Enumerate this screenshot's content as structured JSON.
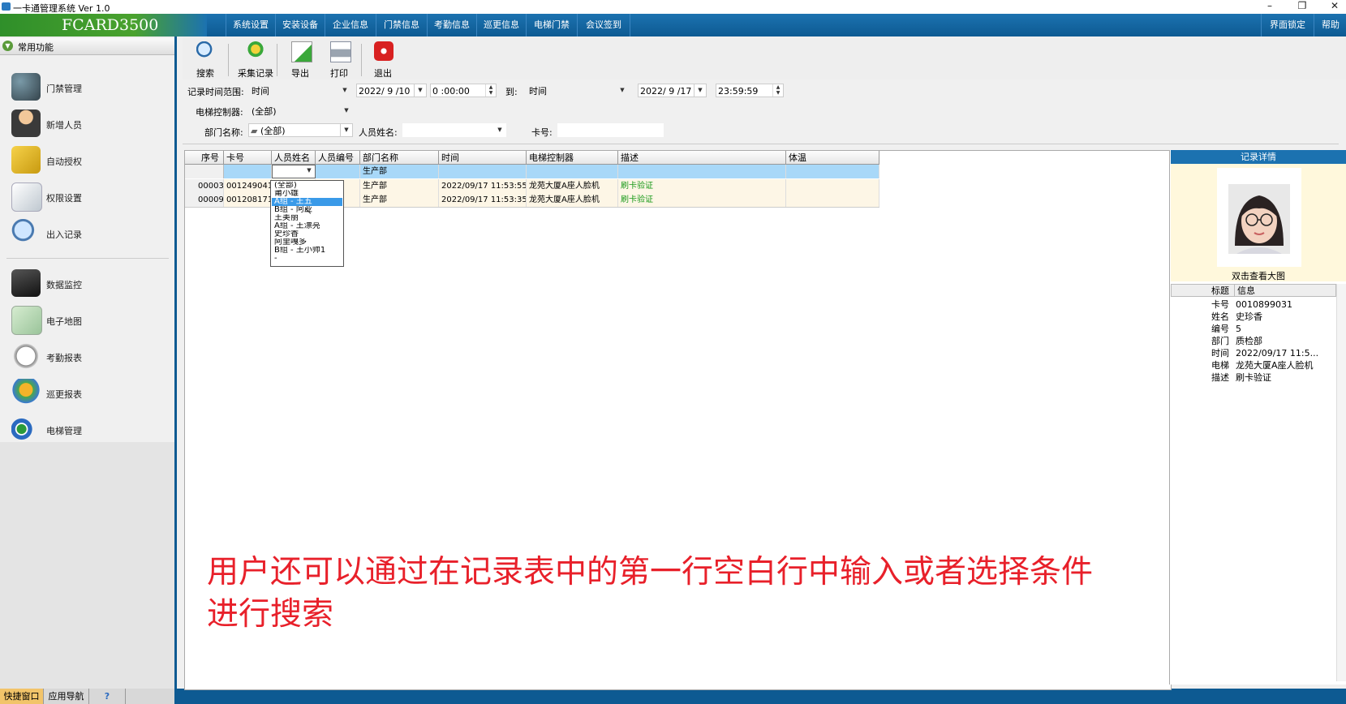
{
  "window": {
    "title": "一卡通管理系统  Ver 1.0",
    "brand": "FCARD3500"
  },
  "menu": [
    "系统设置",
    "安装设备",
    "企业信息",
    "门禁信息",
    "考勤信息",
    "巡更信息",
    "电梯门禁",
    "会议签到"
  ],
  "menu_right": [
    "界面锁定",
    "帮助"
  ],
  "sidebar": {
    "header": "常用功能",
    "items": [
      "门禁管理",
      "新增人员",
      "自动授权",
      "权限设置",
      "出入记录",
      "数据监控",
      "电子地图",
      "考勤报表",
      "巡更报表",
      "电梯管理"
    ],
    "tabs": [
      "快捷窗口",
      "应用导航",
      "?"
    ]
  },
  "toolbar": [
    "搜索",
    "采集记录",
    "导出",
    "打印",
    "退出"
  ],
  "filters": {
    "time_range_label": "记录时间范围:",
    "time_type": "时间",
    "start_date": "2022/ 9 /10",
    "start_time": "0 :00:00",
    "to_label": "到:",
    "end_type": "时间",
    "end_date": "2022/ 9 /17",
    "end_time": "23:59:59",
    "controller_label": "电梯控制器:",
    "controller_value": "(全部)",
    "dept_label": "部门名称:",
    "dept_value": "(全部)",
    "name_label": "人员姓名:",
    "name_value": "",
    "card_label": "卡号:",
    "card_value": ""
  },
  "grid": {
    "columns": [
      "序号",
      "卡号",
      "人员姓名",
      "人员编号",
      "部门名称",
      "时间",
      "电梯控制器",
      "描述",
      "体温"
    ],
    "filter_row": {
      "dept": "生产部"
    },
    "rows": [
      {
        "seq": "00003",
        "card": "0012490419",
        "name": "",
        "no": "",
        "dept": "生产部",
        "time": "2022/09/17 11:53:55",
        "controller": "龙苑大厦A座人脸机",
        "desc": "刷卡验证",
        "temp": ""
      },
      {
        "seq": "00009",
        "card": "0012081715",
        "name": "",
        "no": "",
        "dept": "生产部",
        "time": "2022/09/17 11:53:35",
        "controller": "龙苑大厦A座人脸机",
        "desc": "刷卡验证",
        "temp": ""
      }
    ],
    "dropdown": [
      "(全部)",
      "莆小雄",
      "A组 - 王五",
      "B组 - 阿亚",
      "王美丽",
      "A组 - 王漂亮",
      "史珍香",
      "阿里嘎多",
      "B组 - 王小帅1",
      "-"
    ],
    "dropdown_selected": 2
  },
  "detail": {
    "header": "记录详情",
    "photo_caption": "双击查看大图",
    "col_title": "标题",
    "col_info": "信息",
    "rows": [
      {
        "k": "卡号",
        "v": "0010899031"
      },
      {
        "k": "姓名",
        "v": "史珍香"
      },
      {
        "k": "编号",
        "v": "5"
      },
      {
        "k": "部门",
        "v": "质检部"
      },
      {
        "k": "时间",
        "v": "2022/09/17 11:5..."
      },
      {
        "k": "电梯",
        "v": "龙苑大厦A座人脸机"
      },
      {
        "k": "描述",
        "v": "刷卡验证"
      }
    ]
  },
  "caption": {
    "line1": "用户还可以通过在记录表中的第一行空白行中输入或者选择条件",
    "line2": "进行搜索"
  },
  "colors": {
    "accent": "#0d5a92",
    "brand_green": "#3c9a2c",
    "selected_row": "#a8d8f8",
    "row_bg": "#fdf6e6",
    "desc_green": "#1a9a1a",
    "caption_red": "#e8202a"
  }
}
